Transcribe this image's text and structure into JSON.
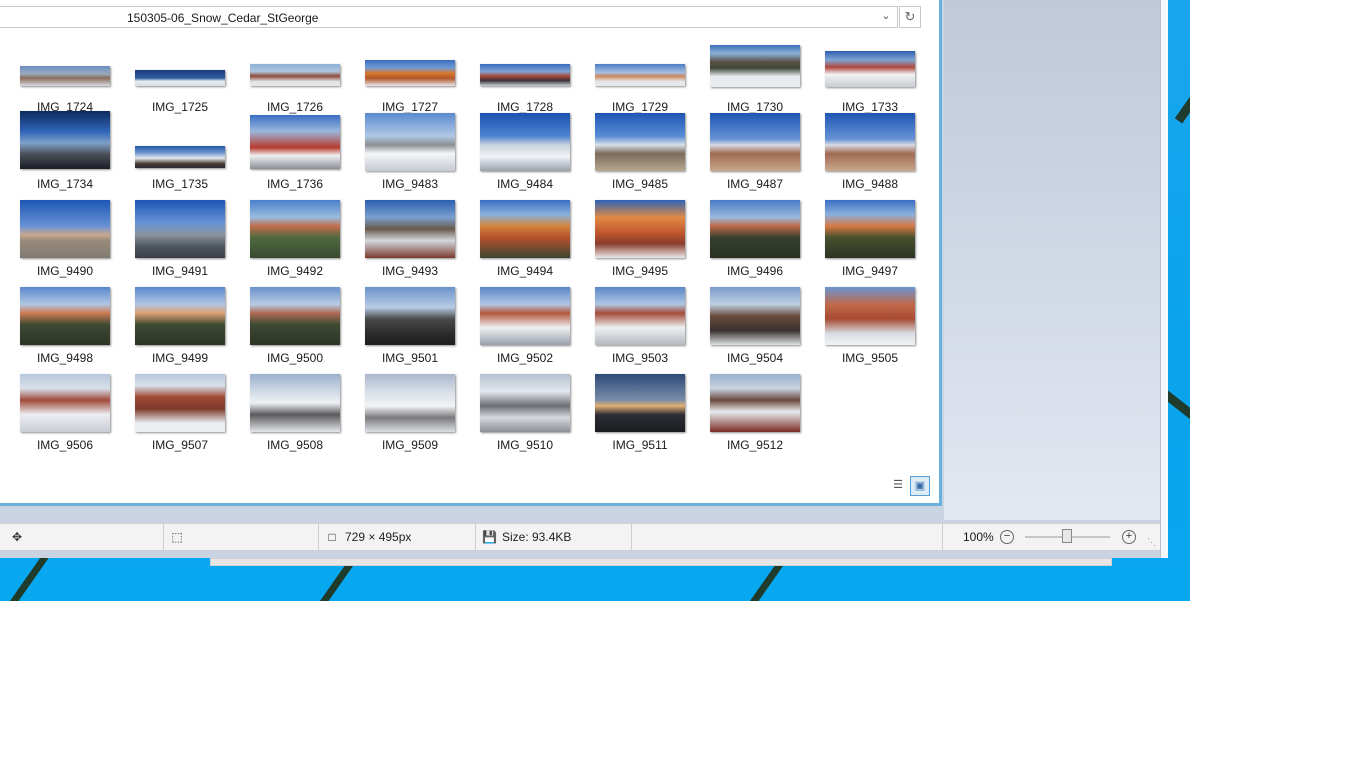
{
  "window": {
    "path": "150305-06_Snow_Cedar_StGeorge",
    "dropdown_icon": "chevron-down-icon",
    "refresh_icon": "refresh-icon"
  },
  "colors": {
    "accent_border": "#6ab0de",
    "desktop": "#0aa3ec",
    "stripe": "#1e3b2c"
  },
  "thumbnails": [
    {
      "label": "IMG_1724"
    },
    {
      "label": "IMG_1725"
    },
    {
      "label": "IMG_1726"
    },
    {
      "label": "IMG_1727"
    },
    {
      "label": "IMG_1728"
    },
    {
      "label": "IMG_1729"
    },
    {
      "label": "IMG_1730"
    },
    {
      "label": "IMG_1733"
    },
    {
      "label": "IMG_1734"
    },
    {
      "label": "IMG_1735"
    },
    {
      "label": "IMG_1736"
    },
    {
      "label": "IMG_9483"
    },
    {
      "label": "IMG_9484"
    },
    {
      "label": "IMG_9485"
    },
    {
      "label": "IMG_9487"
    },
    {
      "label": "IMG_9488"
    },
    {
      "label": "IMG_9490"
    },
    {
      "label": "IMG_9491"
    },
    {
      "label": "IMG_9492"
    },
    {
      "label": "IMG_9493"
    },
    {
      "label": "IMG_9494"
    },
    {
      "label": "IMG_9495"
    },
    {
      "label": "IMG_9496"
    },
    {
      "label": "IMG_9497"
    },
    {
      "label": "IMG_9498"
    },
    {
      "label": "IMG_9499"
    },
    {
      "label": "IMG_9500"
    },
    {
      "label": "IMG_9501"
    },
    {
      "label": "IMG_9502"
    },
    {
      "label": "IMG_9503"
    },
    {
      "label": "IMG_9504"
    },
    {
      "label": "IMG_9505"
    },
    {
      "label": "IMG_9506"
    },
    {
      "label": "IMG_9507"
    },
    {
      "label": "IMG_9508"
    },
    {
      "label": "IMG_9509"
    },
    {
      "label": "IMG_9510"
    },
    {
      "label": "IMG_9511"
    },
    {
      "label": "IMG_9512"
    }
  ],
  "status": {
    "dimensions": "729 × 495px",
    "size": "Size: 93.4KB",
    "zoom": "100%",
    "zoom_level": 0.5
  }
}
